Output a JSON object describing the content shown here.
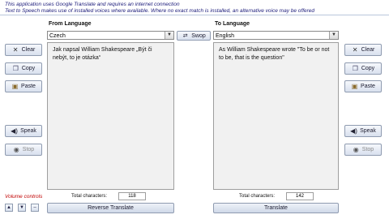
{
  "info": {
    "line1": "This application uses Google Translate and requires an internet connection",
    "line2": "Text to Speech makes use of installed voices where available. Where no exact match is installed, an alternative voice may be offered"
  },
  "from": {
    "label": "From Language",
    "language": "Czech",
    "text": "Jak napsal William Shakespeare „Být či nebýt, to je otázka“",
    "count_label": "Total characters:",
    "count": "118"
  },
  "to": {
    "label": "To Language",
    "language": "English",
    "text": "As William Shakespeare wrote \"To be or not to be, that is the question\"",
    "count_label": "Total characters:",
    "count": "142"
  },
  "swop_label": "Swop",
  "left_buttons": {
    "clear": "Clear",
    "copy": "Copy",
    "paste": "Paste",
    "speak": "Speak",
    "stop": "Stop"
  },
  "right_buttons": {
    "clear": "Clear",
    "copy": "Copy",
    "paste": "Paste",
    "speak": "Speak",
    "stop": "Stop"
  },
  "reverse_translate_label": "Reverse Translate",
  "translate_label": "Translate",
  "volume_label": "Volume controls",
  "icons": {
    "clear": "close-icon",
    "copy": "copy-icon",
    "paste": "paste-icon",
    "speak": "speaker-icon",
    "stop": "stop-icon",
    "swop": "swap-icon"
  }
}
